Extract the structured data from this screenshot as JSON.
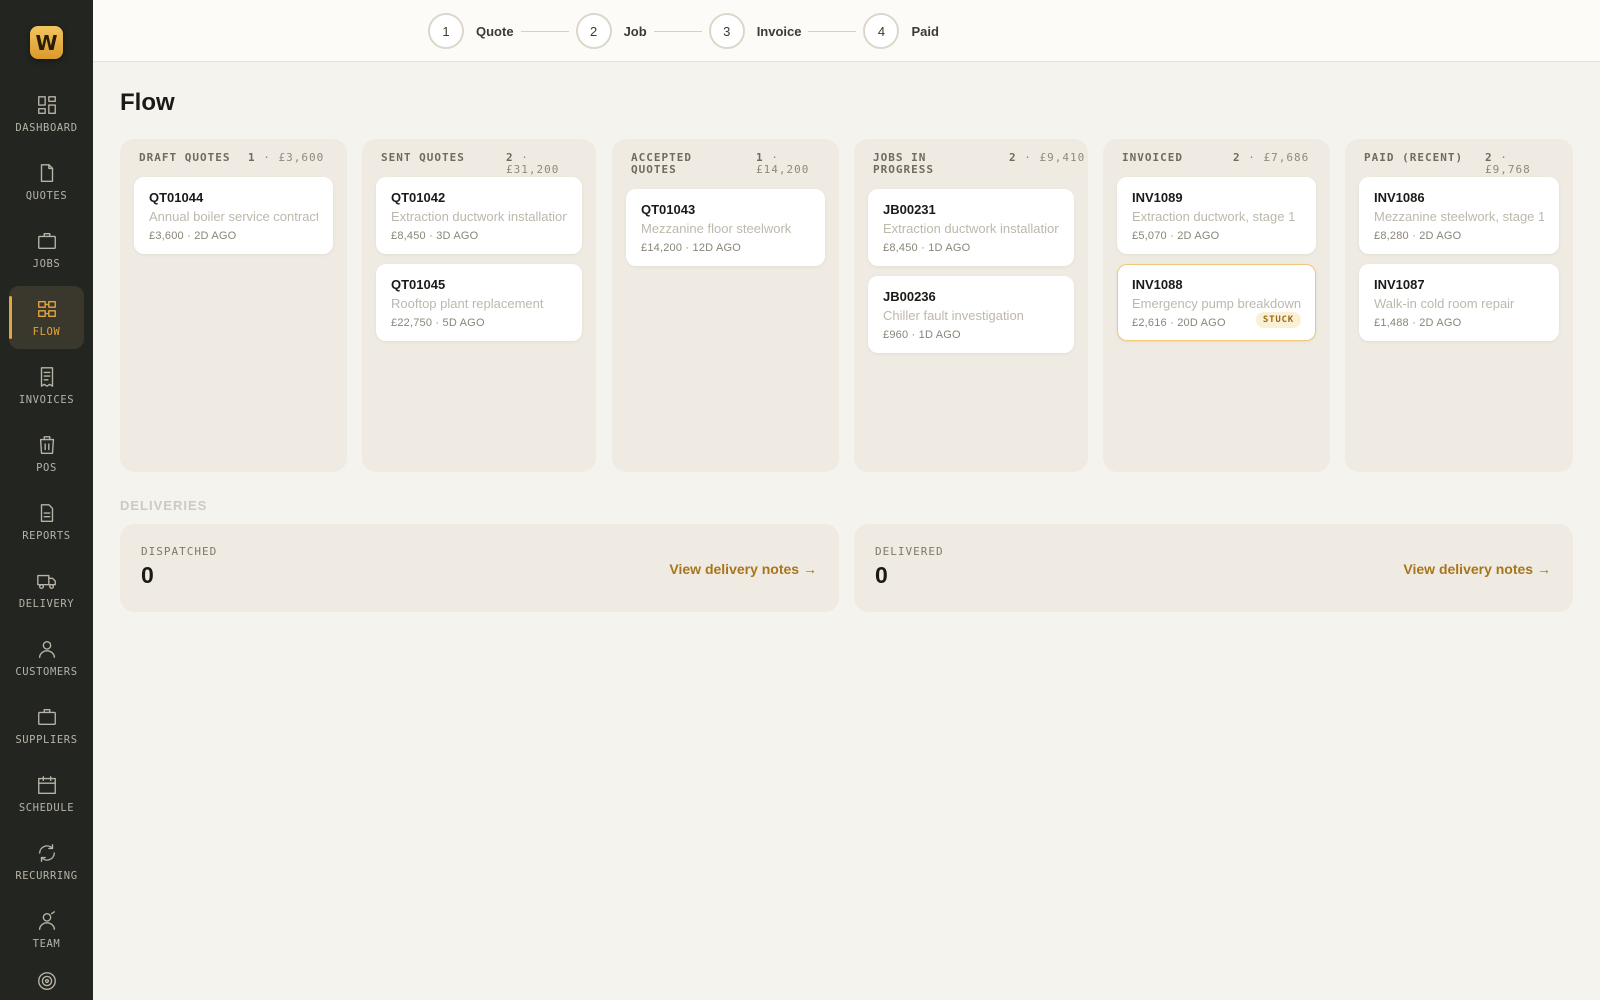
{
  "app": {
    "logo_letter": "W",
    "accent": "#e2a640"
  },
  "sidebar": {
    "items": [
      {
        "label": "DASHBOARD",
        "icon": "dashboard-icon"
      },
      {
        "label": "QUOTES",
        "icon": "document-icon"
      },
      {
        "label": "JOBS",
        "icon": "briefcase-icon"
      },
      {
        "label": "FLOW",
        "icon": "flow-icon",
        "active": true
      },
      {
        "label": "INVOICES",
        "icon": "receipt-icon"
      },
      {
        "label": "POS",
        "icon": "register-icon"
      },
      {
        "label": "REPORTS",
        "icon": "report-icon"
      },
      {
        "label": "DELIVERY",
        "icon": "truck-icon"
      },
      {
        "label": "CUSTOMERS",
        "icon": "user-icon"
      },
      {
        "label": "SUPPLIERS",
        "icon": "briefcase-icon"
      },
      {
        "label": "SCHEDULE",
        "icon": "calendar-icon"
      },
      {
        "label": "RECURRING",
        "icon": "refresh-icon"
      },
      {
        "label": "TEAM",
        "icon": "team-icon"
      }
    ]
  },
  "stepper": {
    "steps": [
      {
        "number": "1",
        "label": "Quote"
      },
      {
        "number": "2",
        "label": "Job"
      },
      {
        "number": "3",
        "label": "Invoice"
      },
      {
        "number": "4",
        "label": "Paid"
      }
    ]
  },
  "page": {
    "title": "Flow"
  },
  "board": {
    "columns": [
      {
        "title": "DRAFT QUOTES",
        "count": "1",
        "total": "£3,600",
        "cards": [
          {
            "id": "QT01044",
            "description": "Annual boiler service contract",
            "meta": "£3,600 · 2D AGO"
          }
        ]
      },
      {
        "title": "SENT QUOTES",
        "count": "2",
        "total": "£31,200",
        "cards": [
          {
            "id": "QT01042",
            "description": "Extraction ductwork installation",
            "meta": "£8,450 · 3D AGO"
          },
          {
            "id": "QT01045",
            "description": "Rooftop plant replacement",
            "meta": "£22,750 · 5D AGO"
          }
        ]
      },
      {
        "title": "ACCEPTED QUOTES",
        "count": "1",
        "total": "£14,200",
        "cards": [
          {
            "id": "QT01043",
            "description": "Mezzanine floor steelwork",
            "meta": "£14,200 · 12D AGO"
          }
        ]
      },
      {
        "title": "JOBS IN PROGRESS",
        "count": "2",
        "total": "£9,410",
        "cards": [
          {
            "id": "JB00231",
            "description": "Extraction ductwork installation",
            "meta": "£8,450 · 1D AGO"
          },
          {
            "id": "JB00236",
            "description": "Chiller fault investigation",
            "meta": "£960 · 1D AGO"
          }
        ]
      },
      {
        "title": "INVOICED",
        "count": "2",
        "total": "£7,686",
        "cards": [
          {
            "id": "INV1089",
            "description": "Extraction ductwork, stage 1",
            "meta": "£5,070 · 2D AGO"
          },
          {
            "id": "INV1088",
            "description": "Emergency pump breakdown",
            "meta": "£2,616 · 20D AGO",
            "badge": "STUCK"
          }
        ]
      },
      {
        "title": "PAID (RECENT)",
        "count": "2",
        "total": "£9,768",
        "cards": [
          {
            "id": "INV1086",
            "description": "Mezzanine steelwork, stage 1",
            "meta": "£8,280 · 2D AGO"
          },
          {
            "id": "INV1087",
            "description": "Walk-in cold room repair",
            "meta": "£1,488 · 2D AGO"
          }
        ]
      }
    ]
  },
  "deliveries": {
    "section_label": "DELIVERIES",
    "dispatched": {
      "label": "DISPATCHED",
      "value": "0",
      "link": "View delivery notes →"
    },
    "delivered": {
      "label": "DELIVERED",
      "value": "0",
      "link": "View delivery notes →"
    }
  }
}
